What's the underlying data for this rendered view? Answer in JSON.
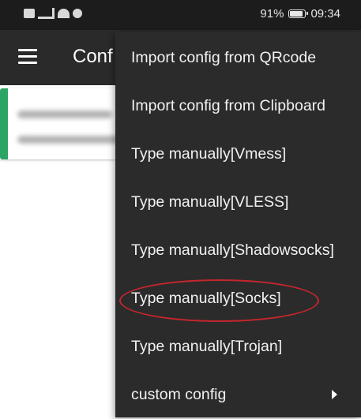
{
  "status_bar": {
    "battery": "91%",
    "battery_level": 0.91,
    "time": "09:34",
    "icons": [
      "hd-icon",
      "signal-icon",
      "wifi-icon",
      "alarm-icon"
    ]
  },
  "app_bar": {
    "title": "Conf",
    "menu_icon": "hamburger-icon"
  },
  "config_card": {
    "accent_color": "#2aa564"
  },
  "menu": {
    "items": [
      {
        "label": "Import config from QRcode"
      },
      {
        "label": "Import config from Clipboard"
      },
      {
        "label": "Type manually[Vmess]"
      },
      {
        "label": "Type manually[VLESS]"
      },
      {
        "label": "Type manually[Shadowsocks]"
      },
      {
        "label": "Type manually[Socks]"
      },
      {
        "label": "Type manually[Trojan]"
      },
      {
        "label": "custom config",
        "submenu_icon": "chevron-right-icon"
      }
    ]
  },
  "annotation": {
    "highlight_color": "#c4262c"
  }
}
